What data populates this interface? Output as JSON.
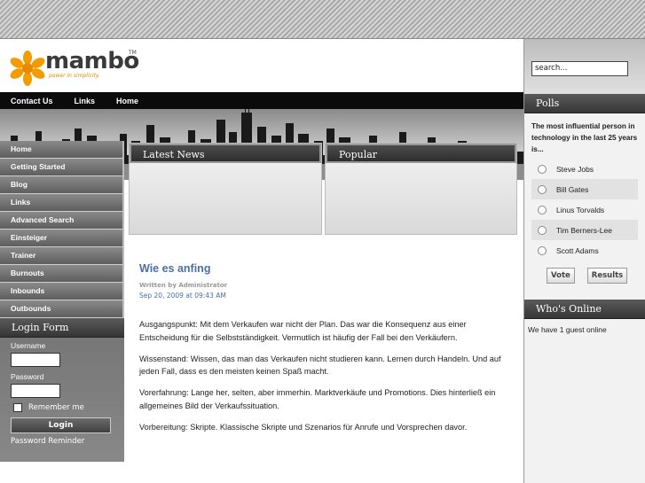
{
  "logo": {
    "name": "mambo",
    "tm": "TM",
    "tagline": "power in simplicity."
  },
  "topnav": [
    "Contact Us",
    "Links",
    "Home"
  ],
  "left_menu": [
    "Home",
    "Getting Started",
    "Blog",
    "Links",
    "Advanced Search",
    "Einsteiger",
    "Trainer",
    "Burnouts",
    "Inbounds",
    "Outbounds"
  ],
  "login": {
    "title": "Login Form",
    "username_label": "Username",
    "password_label": "Password",
    "remember_label": "Remember me",
    "button": "Login",
    "reminder": "Password Reminder"
  },
  "boxes": {
    "latest": "Latest News",
    "popular": "Popular"
  },
  "article": {
    "title": "Wie es anfing",
    "author": "Written by Administrator",
    "date": "Sep 20, 2009 at 09:43 AM",
    "paragraphs": [
      "Ausgangspunkt: Mit dem Verkaufen war nicht der Plan. Das war die Konsequenz aus einer Entscheidung für die Selbstständigkeit. Vermutlich ist häufig der Fall bei den Verkäufern.",
      "Wissenstand: Wissen, das man das Verkaufen nicht studieren kann. Lernen durch Handeln. Und auf jeden Fall, dass es den meisten keinen Spaß macht.",
      "Vorerfahrung: Lange her, selten, aber immerhin. Marktverkäufe und Promotions. Dies hinterließ ein allgemeines Bild der Verkaufssituation.",
      "Vorbereitung: Skripte. Klassische Skripte und Szenarios für Anrufe und Vorsprechen davor."
    ]
  },
  "search": {
    "placeholder": "search..."
  },
  "polls": {
    "title": "Polls",
    "question": "The most influential person in technology in the last 25 years is...",
    "options": [
      "Steve Jobs",
      "Bill Gates",
      "Linus Torvalds",
      "Tim Berners-Lee",
      "Scott Adams"
    ],
    "vote": "Vote",
    "results": "Results"
  },
  "whos_online": {
    "title": "Who's Online",
    "text": "We have 1 guest online"
  }
}
